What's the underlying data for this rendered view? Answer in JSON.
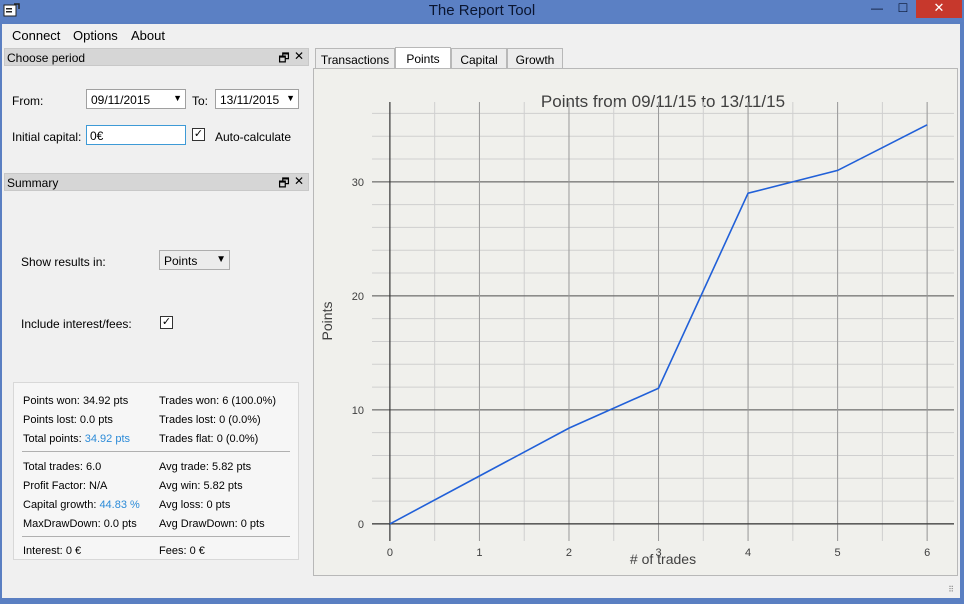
{
  "window": {
    "title": "The Report Tool"
  },
  "menu": [
    "Connect",
    "Options",
    "About"
  ],
  "period": {
    "dock_title": "Choose period",
    "from_label": "From:",
    "from_value": "09/11/2015",
    "to_label": "To:",
    "to_value": "13/11/2015",
    "capital_label": "Initial capital:",
    "capital_value": "0€",
    "auto_label": "Auto-calculate",
    "auto_checked": true
  },
  "summary": {
    "dock_title": "Summary",
    "show_label": "Show results in:",
    "show_value": "Points",
    "include_label": "Include interest/fees:",
    "include_checked": true,
    "stats": {
      "points_won_label": "Points won:",
      "points_won": "34.92 pts",
      "points_lost_label": "Points lost:",
      "points_lost": "0.0 pts",
      "total_points_label": "Total points:",
      "total_points": "34.92 pts",
      "trades_won_label": "Trades won:",
      "trades_won": "6 (100.0%)",
      "trades_lost_label": "Trades lost:",
      "trades_lost": "0 (0.0%)",
      "trades_flat_label": "Trades flat:",
      "trades_flat": "0 (0.0%)",
      "total_trades_label": "Total trades:",
      "total_trades": "6.0",
      "profit_factor_label": "Profit Factor:",
      "profit_factor": "N/A",
      "capital_growth_label": "Capital growth:",
      "capital_growth": "44.83 %",
      "maxdd_label": "MaxDrawDown:",
      "maxdd": "0.0 pts",
      "avg_trade_label": "Avg trade:",
      "avg_trade": "5.82 pts",
      "avg_win_label": "Avg win:",
      "avg_win": "5.82 pts",
      "avg_loss_label": "Avg loss:",
      "avg_loss": "0 pts",
      "avg_dd_label": "Avg DrawDown:",
      "avg_dd": "0 pts",
      "interest_label": "Interest:",
      "interest": "0 €",
      "fees_label": "Fees:",
      "fees": "0 €"
    }
  },
  "tabs": [
    "Transactions",
    "Points",
    "Capital",
    "Growth"
  ],
  "active_tab": "Points",
  "colors": {
    "line": "#2160d8",
    "accent": "#2c8bd8",
    "close": "#c7382c"
  },
  "chart_data": {
    "type": "line",
    "title": "Points from 09/11/15 to 13/11/15",
    "xlabel": "# of trades",
    "ylabel": "Points",
    "x": [
      0,
      1,
      2,
      3,
      4,
      5,
      6
    ],
    "values": [
      0,
      4.2,
      8.4,
      11.9,
      29.0,
      31.0,
      35.0
    ],
    "xlim": [
      -0.2,
      6.3
    ],
    "ylim": [
      -1.5,
      37
    ],
    "xticks": [
      0,
      1,
      2,
      3,
      4,
      5,
      6
    ],
    "yticks": [
      0,
      10,
      20,
      30
    ],
    "grid": true
  }
}
